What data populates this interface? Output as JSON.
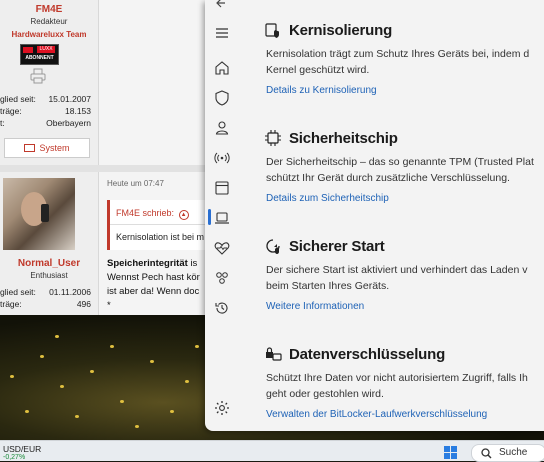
{
  "forum": {
    "user1": {
      "name": "FM4E",
      "role": "Redakteur",
      "team": "Hardwareluxx Team",
      "badge_top": "LUXX",
      "badge_bottom": "ABONNENT",
      "joined_label": "glied seit:",
      "joined_value": "15.01.2007",
      "posts_label": "träge:",
      "posts_value": "18.153",
      "location_label": "t:",
      "location_value": "Oberbayern",
      "system_button": "System"
    },
    "user2": {
      "name": "Normal_User",
      "role": "Enthusiast",
      "joined_label": "glied seit:",
      "joined_value": "01.11.2006",
      "posts_label": "träge:",
      "posts_value": "496"
    },
    "post": {
      "timestamp": "Heute um 07:47",
      "quote_author": "FM4E schrieb:",
      "quote_text": "Kernisolation ist bei m",
      "line1_bold": "Speicherintegrität",
      "line1_rest": " is",
      "line2": "Wennst Pech hast kör",
      "line3": "ist aber da! Wenn doc",
      "line4": "*"
    }
  },
  "security": {
    "sections": [
      {
        "icon": "core-isolation-icon",
        "title": "Kernisolierung",
        "desc_line1": "Kernisolation trägt zum Schutz Ihres Geräts bei, indem d",
        "desc_line2": "Kernel geschützt wird.",
        "link": "Details zu Kernisolierung"
      },
      {
        "icon": "chip-icon",
        "title": "Sicherheitschip",
        "desc_line1": "Der Sicherheitschip – das so genannte TPM (Trusted Plat",
        "desc_line2": "schützt Ihr Gerät durch zusätzliche Verschlüsselung.",
        "link": "Details zum Sicherheitschip"
      },
      {
        "icon": "secure-boot-icon",
        "title": "Sicherer Start",
        "desc_line1": "Der sichere Start ist aktiviert und verhindert das Laden v",
        "desc_line2": "beim Starten Ihres Geräts.",
        "link": "Weitere Informationen"
      },
      {
        "icon": "data-encryption-icon",
        "title": "Datenverschlüsselung",
        "desc_line1": "Schützt Ihre Daten vor nicht autorisiertem Zugriff, falls Ih",
        "desc_line2": "geht oder gestohlen wird.",
        "link": "Verwalten der BitLocker-Laufwerkverschlüsselung"
      }
    ],
    "nav_icons": [
      "back-arrow-icon",
      "hamburger-menu-icon",
      "home-icon",
      "shield-icon",
      "account-icon",
      "wireless-icon",
      "app-browser-icon",
      "device-laptop-icon",
      "heart-icon",
      "family-icon",
      "history-icon",
      "settings-gear-icon"
    ],
    "accent_color": "#2a6fd1",
    "link_color": "#1e62b6"
  },
  "taskbar": {
    "ticker_name": "USD/EUR",
    "ticker_change": "-0,27%",
    "search_label": "Suche"
  }
}
